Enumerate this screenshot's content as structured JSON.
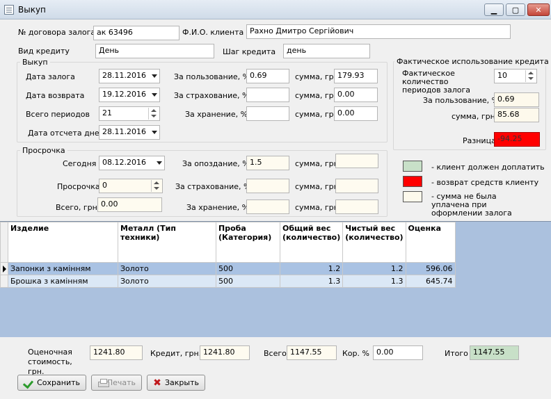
{
  "window": {
    "title": "Выкуп"
  },
  "header": {
    "contract_label": "№ договора залога",
    "contract_value": "ак 63496",
    "client_label": "Ф.И.О. клиента",
    "client_value": "Рахно Дмитро Сергійович",
    "credit_type_label": "Вид кредиту",
    "credit_type_value": "День",
    "step_label": "Шаг кредита",
    "step_value": "день"
  },
  "buyout": {
    "title": "Выкуп",
    "pledge_date_label": "Дата залога",
    "pledge_date": "28.11.2016",
    "return_date_label": "Дата возврата",
    "return_date": "19.12.2016",
    "periods_label": "Всего периодов",
    "periods": "21",
    "count_date_label": "Дата отсчета дней",
    "count_date": "28.11.2016",
    "usage_label": "За пользование, %",
    "usage_pct": "0.69",
    "insurance_label": "За страхование, %",
    "insurance_pct": "",
    "storage_label": "За хранение, %",
    "storage_pct": "",
    "sum_label": "сумма, грн.",
    "usage_sum": "179.93",
    "insurance_sum": "0.00",
    "storage_sum": "0.00"
  },
  "overdue": {
    "title": "Просрочка",
    "today_label": "Сегодня",
    "today": "08.12.2016",
    "overdue_label": "Просрочка",
    "overdue": "0",
    "total_label": "Всего, грн.",
    "total": "0.00",
    "late_label": "За опоздание, %",
    "late_pct": "1.5",
    "insurance_label": "За страхование, %",
    "insurance_pct": "",
    "storage_label": "За хранение, %",
    "storage_pct": "",
    "sum_label": "сумма, грн.",
    "late_sum": "",
    "insurance_sum": "",
    "storage_sum": ""
  },
  "actual": {
    "title": "Фактическое использование кредита",
    "periods_label": "Фактическое количество периодов залога",
    "periods": "10",
    "usage_label": "За пользование, %",
    "usage_pct": "0.69",
    "sum_label": "сумма, грн.",
    "sum": "85.68",
    "diff_label": "Разница",
    "diff": "-94.25"
  },
  "legend": {
    "items": [
      {
        "text": "- клиент должен доплатить",
        "color": "#c8e0c8"
      },
      {
        "text": "- возврат средств клиенту",
        "color": "#ff0000"
      },
      {
        "text": "- сумма не была уплачена при оформлении залога",
        "color": "#fdf9ec"
      }
    ]
  },
  "grid": {
    "columns": [
      "Изделие",
      "Металл (Тип техники)",
      "Проба (Категория)",
      "Общий вес (количество)",
      "Чистый вес (количество)",
      "Оценка"
    ],
    "rows": [
      {
        "item": "Запонки з камінням",
        "metal": "Золото",
        "probe": "500",
        "gross": "1.2",
        "net": "1.2",
        "value": "596.06"
      },
      {
        "item": "Брошка з камінням",
        "metal": "Золото",
        "probe": "500",
        "gross": "1.3",
        "net": "1.3",
        "value": "645.74"
      }
    ]
  },
  "footer": {
    "estimate_label": "Оценочная стоимость, грн.",
    "estimate": "1241.80",
    "credit_label": "Кредит, грн.",
    "credit": "1241.80",
    "total_label": "Всего",
    "total": "1147.55",
    "kor_label": "Кор. %",
    "kor": "0.00",
    "itogo_label": "Итого",
    "itogo": "1147.55",
    "save_label": "Сохранить",
    "print_label": "Печать",
    "close_label": "Закрыть"
  }
}
